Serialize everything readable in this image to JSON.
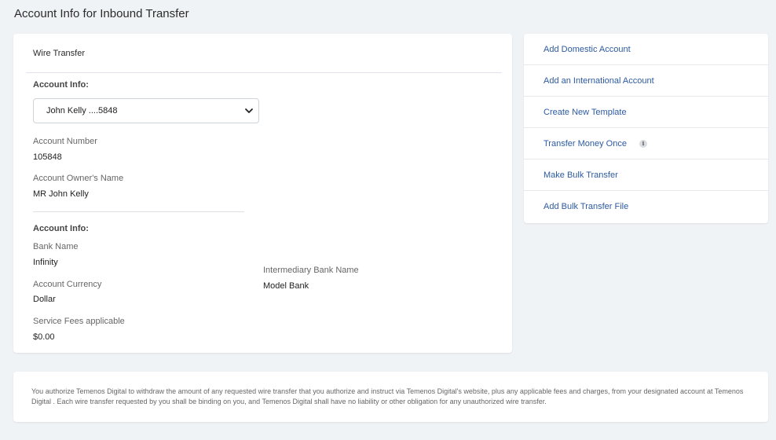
{
  "page": {
    "title": "Account Info for Inbound Transfer"
  },
  "main": {
    "header": "Wire Transfer",
    "account_section_label": "Account Info:",
    "account_select": {
      "selected": "John Kelly ....5848",
      "icon": "chevron-down-icon"
    },
    "account_number": {
      "label": "Account Number",
      "value": "105848"
    },
    "owner_name": {
      "label": "Account Owner's Name",
      "value": "MR John Kelly"
    },
    "bank_section_label": "Account Info:",
    "bank_name": {
      "label": "Bank Name",
      "value": "Infinity"
    },
    "account_currency": {
      "label": "Account Currency",
      "value": "Dollar"
    },
    "service_fees": {
      "label": "Service Fees applicable",
      "value": "$0.00"
    },
    "intermediary_bank": {
      "label": "Intermediary Bank Name",
      "value": "Model Bank"
    }
  },
  "sidebar": {
    "items": [
      {
        "label": "Add Domestic Account"
      },
      {
        "label": "Add an International Account"
      },
      {
        "label": "Create New Template"
      },
      {
        "label": "Transfer Money Once",
        "icon": "info-icon",
        "icon_glyph": "i"
      },
      {
        "label": "Make Bulk Transfer"
      },
      {
        "label": "Add Bulk Transfer File"
      }
    ]
  },
  "disclaimer": {
    "text": "You authorize Temenos Digital to withdraw the amount of any requested wire transfer that you authorize and instruct via Temenos Digital's website, plus any applicable fees and charges, from your designated account at Temenos Digital . Each wire transfer requested by you shall be binding on you, and Temenos Digital shall have no liability or other obligation for any unauthorized wire transfer."
  },
  "colors": {
    "link": "#2c5aa0",
    "background": "#f0f3f6",
    "card": "#ffffff"
  }
}
